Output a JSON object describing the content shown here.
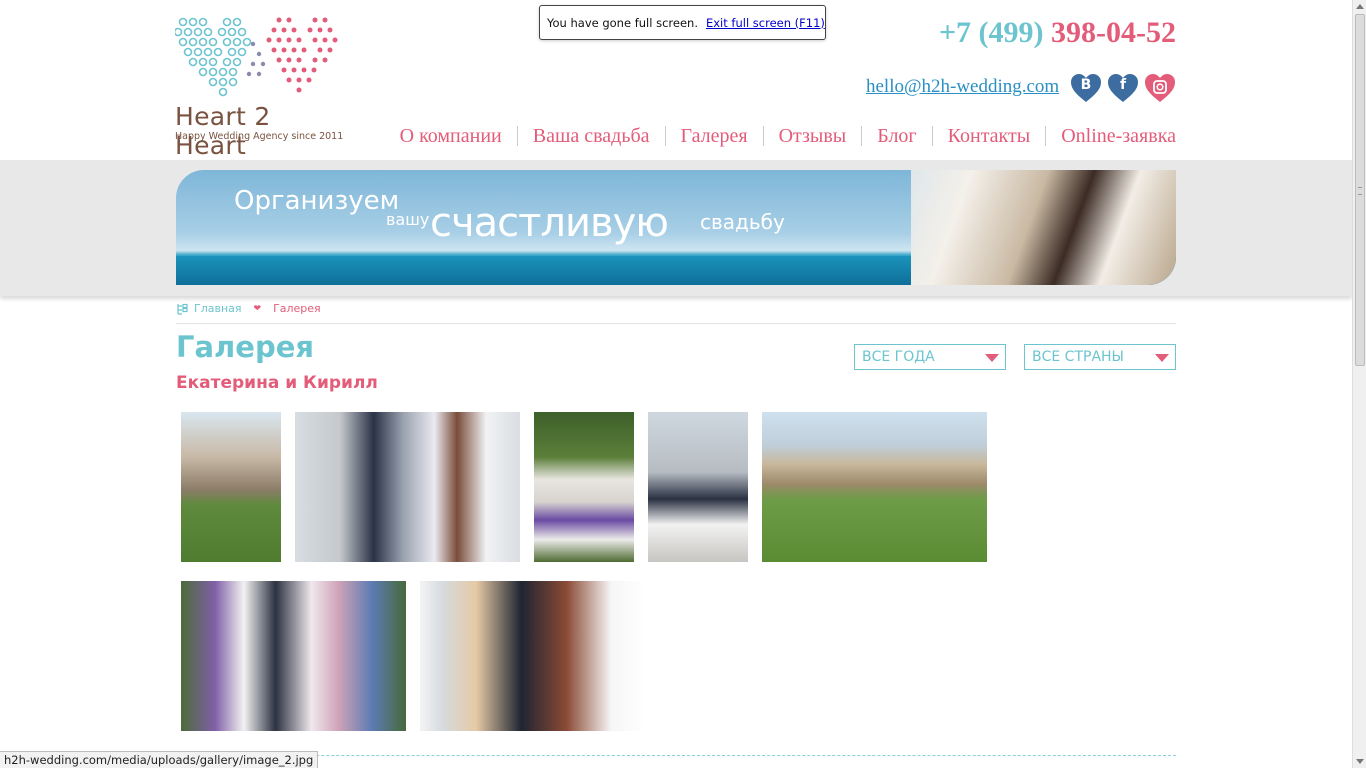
{
  "logo": {
    "name": "Heart 2 Heart",
    "tagline": "Happy Wedding Agency since 2011"
  },
  "fullscreen_notice": {
    "text": "You have gone full screen.",
    "exit_label": "Exit full screen (F11)"
  },
  "contacts": {
    "phone_code": "+7 (499)",
    "phone_number": "398-04-52",
    "email": "hello@h2h-wedding.com"
  },
  "social": [
    {
      "icon": "vk-icon",
      "label": "В"
    },
    {
      "icon": "facebook-icon",
      "label": "f"
    },
    {
      "icon": "instagram-icon",
      "label": ""
    }
  ],
  "nav": [
    "О компании",
    "Ваша свадьба",
    "Галерея",
    "Отзывы",
    "Блог",
    "Контакты",
    "Online-заявка"
  ],
  "banner": {
    "line1": "Организуем",
    "line2": "вашу",
    "line3": "счастливую",
    "line4": "свадьбу"
  },
  "breadcrumb": {
    "home": "Главная",
    "current": "Галерея"
  },
  "page": {
    "title": "Галерея",
    "subtitle": "Екатерина и Кирилл"
  },
  "filters": {
    "years": "ВСЕ ГОДА",
    "countries": "ВСЕ СТРАНЫ"
  },
  "gallery_count": 7,
  "status_url": "h2h-wedding.com/media/uploads/gallery/image_2.jpg",
  "colors": {
    "pink": "#e35c79",
    "teal": "#6cc4cf",
    "brown": "#7a5240",
    "link_blue": "#2a8fc4"
  }
}
